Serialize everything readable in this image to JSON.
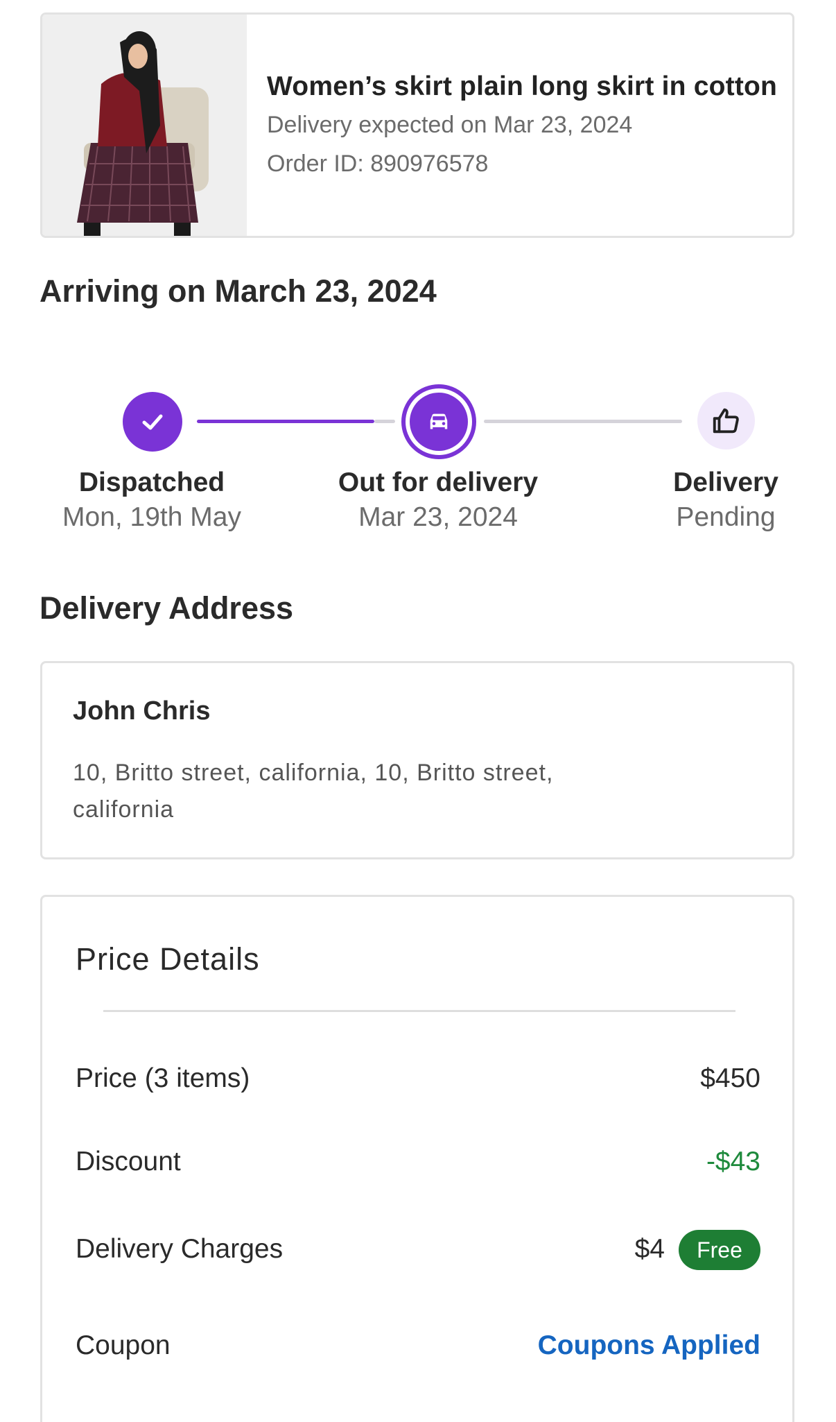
{
  "order": {
    "product_title": "Women’s skirt plain long skirt in cotton",
    "delivery_expected": "Delivery expected on Mar 23, 2024",
    "order_id": "Order ID: 890976578"
  },
  "arriving": "Arriving on March 23, 2024",
  "tracker": {
    "steps": [
      {
        "title": "Dispatched",
        "sub": "Mon, 19th May",
        "icon": "check-icon",
        "state": "done"
      },
      {
        "title": "Out for delivery",
        "sub": "Mar 23, 2024",
        "icon": "car-icon",
        "state": "current"
      },
      {
        "title": "Delivery",
        "sub": "Pending",
        "icon": "thumbs-up-icon",
        "state": "pending"
      }
    ]
  },
  "address": {
    "heading": "Delivery Address",
    "name": "John Chris",
    "text": "10, Britto street, california, 10, Britto street, california"
  },
  "price": {
    "heading": "Price Details",
    "rows": [
      {
        "label": "Price (3 items)",
        "value": "$450"
      },
      {
        "label": "Discount",
        "value": "-$43"
      },
      {
        "label": "Delivery Charges",
        "value": "$4",
        "badge": "Free"
      },
      {
        "label": "Coupon",
        "value": "Coupons Applied"
      }
    ]
  },
  "colors": {
    "accent": "#7a33d6",
    "accent_light": "#f1e9fb",
    "track_pending": "#d5d3da",
    "discount_green": "#1e8a3c",
    "badge_green": "#1e7e34",
    "link_blue": "#1565c0"
  }
}
